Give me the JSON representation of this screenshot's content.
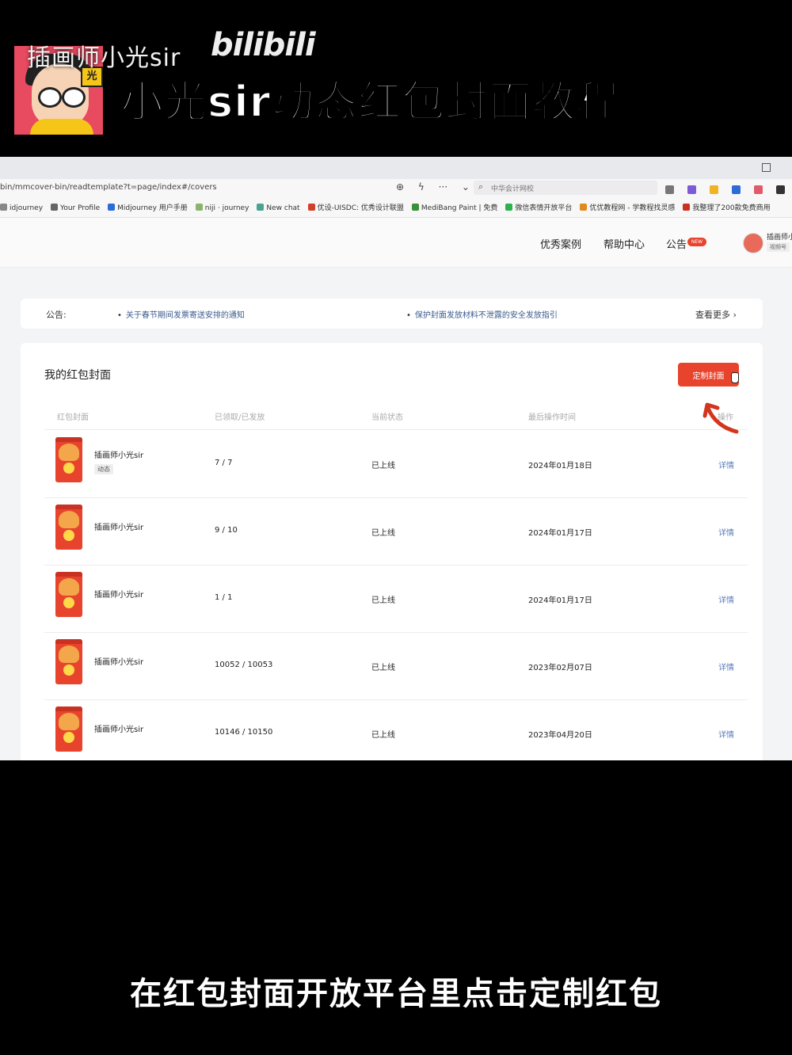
{
  "overlay": {
    "channel_name": "插画师小光sir",
    "platform_logo": "bilibili",
    "video_title": "小光sir动态红包封面教程",
    "subtitle": "在红包封面开放平台里点击定制红包",
    "avatar_badge": "光"
  },
  "browser": {
    "url": "bin/mmcover-bin/readtemplate?t=page/index#/covers",
    "search_placeholder": "中华会计网校",
    "bookmarks": [
      {
        "label": "idjourney",
        "color": "#888888"
      },
      {
        "label": "Your Profile",
        "color": "#666666"
      },
      {
        "label": "Midjourney 用户手册",
        "color": "#2d6bd9"
      },
      {
        "label": "niji · journey",
        "color": "#8bb36b"
      },
      {
        "label": "New chat",
        "color": "#4aa38e"
      },
      {
        "label": "优设-UISDC: 优秀设计联盟",
        "color": "#d0402a"
      },
      {
        "label": "MediBang Paint | 免费",
        "color": "#3a8f3a"
      },
      {
        "label": "微信表情开放平台",
        "color": "#2bb24c"
      },
      {
        "label": "优优教程网 - 学教程找灵感",
        "color": "#e08a1e"
      },
      {
        "label": "我整理了200款免费商用",
        "color": "#c93122"
      }
    ]
  },
  "header": {
    "nav": [
      "优秀案例",
      "帮助中心",
      "公告"
    ],
    "new_badge": "NEW",
    "user_name": "插画师小",
    "user_tag": "视频号"
  },
  "notice": {
    "label": "公告:",
    "items": [
      "关于春节期间发票寄送安排的通知",
      "保护封面发放材料不泄露的安全发放指引"
    ],
    "more": "查看更多 ›"
  },
  "panel": {
    "title": "我的红包封面",
    "custom_button": "定制封面",
    "columns": [
      "红包封面",
      "已领取/已发放",
      "当前状态",
      "最后操作时间",
      "操作"
    ],
    "rows": [
      {
        "name": "插画师小光sir",
        "tag": "动态",
        "count": "7 / 7",
        "status": "已上线",
        "time": "2024年01月18日",
        "action": "详情"
      },
      {
        "name": "插画师小光sir",
        "count": "9 / 10",
        "status": "已上线",
        "time": "2024年01月17日",
        "action": "详情"
      },
      {
        "name": "插画师小光sir",
        "count": "1 / 1",
        "status": "已上线",
        "time": "2024年01月17日",
        "action": "详情"
      },
      {
        "name": "插画师小光sir",
        "count": "10052 / 10053",
        "status": "已上线",
        "time": "2023年02月07日",
        "action": "详情"
      },
      {
        "name": "插画师小光sir",
        "count": "10146 / 10150",
        "status": "已上线",
        "time": "2023年04月20日",
        "action": "详情"
      }
    ]
  },
  "colors": {
    "accent": "#e8442d",
    "link": "#5a7bbd",
    "annotation_arrow": "#d4351c"
  }
}
